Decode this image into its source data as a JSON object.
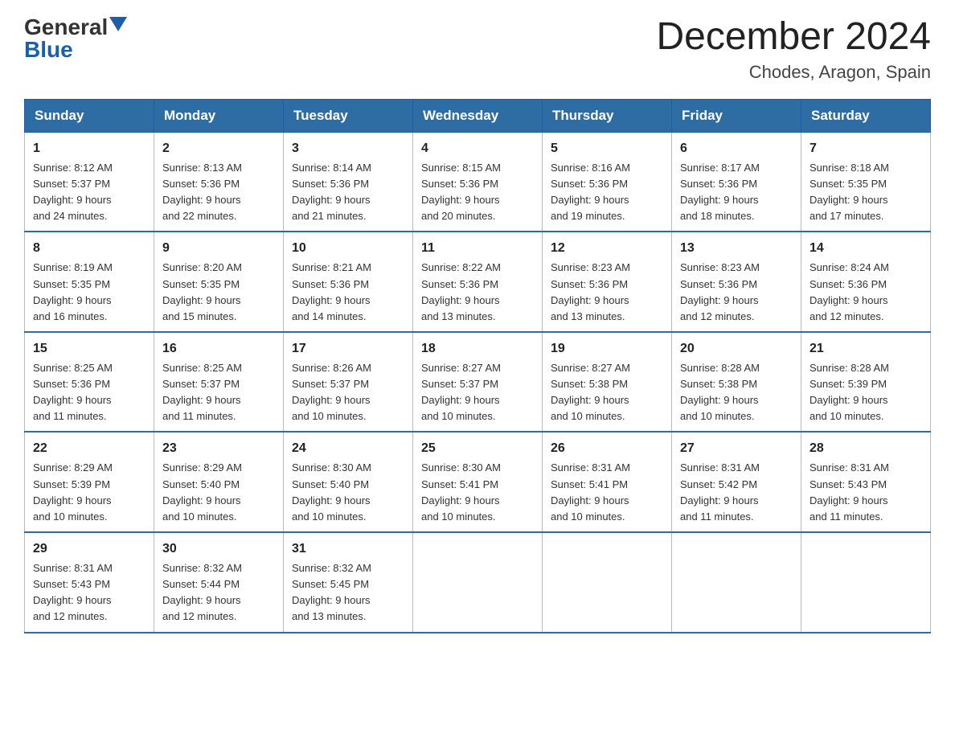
{
  "header": {
    "logo": {
      "general": "General",
      "blue": "Blue",
      "arrow": "▲"
    },
    "title": "December 2024",
    "location": "Chodes, Aragon, Spain"
  },
  "days_of_week": [
    "Sunday",
    "Monday",
    "Tuesday",
    "Wednesday",
    "Thursday",
    "Friday",
    "Saturday"
  ],
  "weeks": [
    [
      {
        "day": "1",
        "sunrise": "8:12 AM",
        "sunset": "5:37 PM",
        "daylight": "9 hours and 24 minutes."
      },
      {
        "day": "2",
        "sunrise": "8:13 AM",
        "sunset": "5:36 PM",
        "daylight": "9 hours and 22 minutes."
      },
      {
        "day": "3",
        "sunrise": "8:14 AM",
        "sunset": "5:36 PM",
        "daylight": "9 hours and 21 minutes."
      },
      {
        "day": "4",
        "sunrise": "8:15 AM",
        "sunset": "5:36 PM",
        "daylight": "9 hours and 20 minutes."
      },
      {
        "day": "5",
        "sunrise": "8:16 AM",
        "sunset": "5:36 PM",
        "daylight": "9 hours and 19 minutes."
      },
      {
        "day": "6",
        "sunrise": "8:17 AM",
        "sunset": "5:36 PM",
        "daylight": "9 hours and 18 minutes."
      },
      {
        "day": "7",
        "sunrise": "8:18 AM",
        "sunset": "5:35 PM",
        "daylight": "9 hours and 17 minutes."
      }
    ],
    [
      {
        "day": "8",
        "sunrise": "8:19 AM",
        "sunset": "5:35 PM",
        "daylight": "9 hours and 16 minutes."
      },
      {
        "day": "9",
        "sunrise": "8:20 AM",
        "sunset": "5:35 PM",
        "daylight": "9 hours and 15 minutes."
      },
      {
        "day": "10",
        "sunrise": "8:21 AM",
        "sunset": "5:36 PM",
        "daylight": "9 hours and 14 minutes."
      },
      {
        "day": "11",
        "sunrise": "8:22 AM",
        "sunset": "5:36 PM",
        "daylight": "9 hours and 13 minutes."
      },
      {
        "day": "12",
        "sunrise": "8:23 AM",
        "sunset": "5:36 PM",
        "daylight": "9 hours and 13 minutes."
      },
      {
        "day": "13",
        "sunrise": "8:23 AM",
        "sunset": "5:36 PM",
        "daylight": "9 hours and 12 minutes."
      },
      {
        "day": "14",
        "sunrise": "8:24 AM",
        "sunset": "5:36 PM",
        "daylight": "9 hours and 12 minutes."
      }
    ],
    [
      {
        "day": "15",
        "sunrise": "8:25 AM",
        "sunset": "5:36 PM",
        "daylight": "9 hours and 11 minutes."
      },
      {
        "day": "16",
        "sunrise": "8:25 AM",
        "sunset": "5:37 PM",
        "daylight": "9 hours and 11 minutes."
      },
      {
        "day": "17",
        "sunrise": "8:26 AM",
        "sunset": "5:37 PM",
        "daylight": "9 hours and 10 minutes."
      },
      {
        "day": "18",
        "sunrise": "8:27 AM",
        "sunset": "5:37 PM",
        "daylight": "9 hours and 10 minutes."
      },
      {
        "day": "19",
        "sunrise": "8:27 AM",
        "sunset": "5:38 PM",
        "daylight": "9 hours and 10 minutes."
      },
      {
        "day": "20",
        "sunrise": "8:28 AM",
        "sunset": "5:38 PM",
        "daylight": "9 hours and 10 minutes."
      },
      {
        "day": "21",
        "sunrise": "8:28 AM",
        "sunset": "5:39 PM",
        "daylight": "9 hours and 10 minutes."
      }
    ],
    [
      {
        "day": "22",
        "sunrise": "8:29 AM",
        "sunset": "5:39 PM",
        "daylight": "9 hours and 10 minutes."
      },
      {
        "day": "23",
        "sunrise": "8:29 AM",
        "sunset": "5:40 PM",
        "daylight": "9 hours and 10 minutes."
      },
      {
        "day": "24",
        "sunrise": "8:30 AM",
        "sunset": "5:40 PM",
        "daylight": "9 hours and 10 minutes."
      },
      {
        "day": "25",
        "sunrise": "8:30 AM",
        "sunset": "5:41 PM",
        "daylight": "9 hours and 10 minutes."
      },
      {
        "day": "26",
        "sunrise": "8:31 AM",
        "sunset": "5:41 PM",
        "daylight": "9 hours and 10 minutes."
      },
      {
        "day": "27",
        "sunrise": "8:31 AM",
        "sunset": "5:42 PM",
        "daylight": "9 hours and 11 minutes."
      },
      {
        "day": "28",
        "sunrise": "8:31 AM",
        "sunset": "5:43 PM",
        "daylight": "9 hours and 11 minutes."
      }
    ],
    [
      {
        "day": "29",
        "sunrise": "8:31 AM",
        "sunset": "5:43 PM",
        "daylight": "9 hours and 12 minutes."
      },
      {
        "day": "30",
        "sunrise": "8:32 AM",
        "sunset": "5:44 PM",
        "daylight": "9 hours and 12 minutes."
      },
      {
        "day": "31",
        "sunrise": "8:32 AM",
        "sunset": "5:45 PM",
        "daylight": "9 hours and 13 minutes."
      },
      null,
      null,
      null,
      null
    ]
  ],
  "labels": {
    "sunrise_prefix": "Sunrise: ",
    "sunset_prefix": "Sunset: ",
    "daylight_prefix": "Daylight: "
  }
}
